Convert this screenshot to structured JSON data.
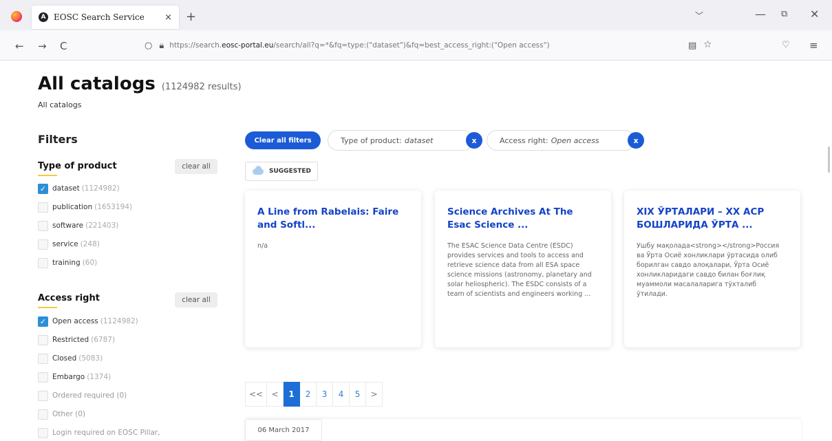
{
  "browser": {
    "tab_title": "EOSC Search Service",
    "tab_close": "×",
    "new_tab": "+",
    "tabs_list": "﹀",
    "win_min": "—",
    "win_max": "⧉",
    "win_close": "✕",
    "back": "←",
    "forward": "→",
    "reload": "C",
    "url_prefix": "https://search.",
    "url_domain": "eosc-portal.eu",
    "url_path": "/search/all?q=*&fq=type:(\"dataset\")&fq=best_access_right:(\"Open access\")",
    "reader_icon": "▤",
    "star_icon": "☆",
    "pocket_icon": "♡",
    "menu_icon": "≡"
  },
  "header": {
    "title": "All catalogs",
    "count": "(1124982 results)",
    "breadcrumb": "All catalogs"
  },
  "filters": {
    "heading": "Filters",
    "type_of_product": {
      "heading": "Type of product",
      "clear_label": "clear all",
      "items": [
        {
          "label": "dataset",
          "count": "(1124982)",
          "checked": true
        },
        {
          "label": "publication",
          "count": "(1653194)",
          "checked": false
        },
        {
          "label": "software",
          "count": "(221403)",
          "checked": false
        },
        {
          "label": "service",
          "count": "(248)",
          "checked": false
        },
        {
          "label": "training",
          "count": "(60)",
          "checked": false
        }
      ]
    },
    "access_right": {
      "heading": "Access right",
      "clear_label": "clear all",
      "items": [
        {
          "label": "Open access",
          "count": "(1124982)",
          "checked": true
        },
        {
          "label": "Restricted",
          "count": "(6787)",
          "checked": false
        },
        {
          "label": "Closed",
          "count": "(5083)",
          "checked": false
        },
        {
          "label": "Embargo",
          "count": "(1374)",
          "checked": false
        },
        {
          "label": "Ordered required (0)",
          "count": "",
          "checked": false
        },
        {
          "label": "Other (0)",
          "count": "",
          "checked": false
        },
        {
          "label": "Login required on EOSC Pillar,",
          "count": "",
          "checked": false
        }
      ]
    }
  },
  "active_filters": {
    "clear_all": "Clear all filters",
    "chips": [
      {
        "prefix": "Type of product:",
        "value": "dataset"
      },
      {
        "prefix": "Access right:",
        "value": "Open access"
      }
    ],
    "chip_remove": "x",
    "suggested": "SUGGESTED"
  },
  "cards": [
    {
      "title": "A Line from Rabelais: Faire and Softl...",
      "description": "n/a"
    },
    {
      "title": "Science Archives At The Esac Science ...",
      "description": "The ESAC Science Data Centre (ESDC) provides services and tools to access and retrieve science data from all ESA space science missions (astronomy, planetary and solar heliospheric). The ESDC consists of a team of scientists and engineers working ..."
    },
    {
      "title": "XIX ЎРТАЛАРИ – XX АСР БОШЛАРИДА ЎРТА ...",
      "description": "Ушбу мақолада<strong></strong>Россия ва Ўрта Осиё хонликлари ўртасида олиб борилган савдо алоқалари, Ўрта Осиё хонликларидаги савдо билан боғлиқ муаммоли масалаларига тўхталиб ўтилади."
    }
  ],
  "pagination": {
    "first": "<<",
    "prev": "<",
    "pages": [
      "1",
      "2",
      "3",
      "4",
      "5"
    ],
    "next": ">",
    "current": "1"
  },
  "next_result": {
    "date": "06 March 2017"
  }
}
